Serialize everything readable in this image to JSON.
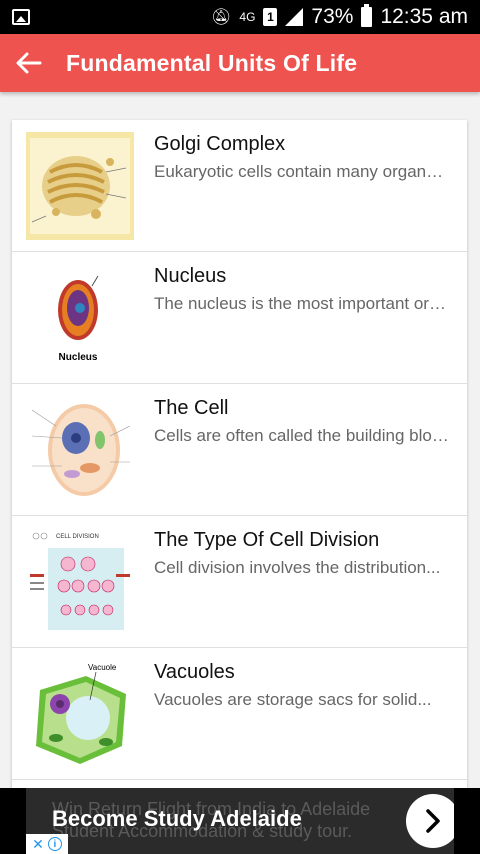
{
  "status_bar": {
    "network": "4G",
    "sim": "1",
    "battery": "73%",
    "time": "12:35 am"
  },
  "app_bar": {
    "back_icon": "arrow-left-icon",
    "title": "Fundamental Units Of Life"
  },
  "list": {
    "items": [
      {
        "title": "Golgi Complex",
        "description": "Eukaryotic cells contain many organelles..."
      },
      {
        "title": "Nucleus",
        "description": "The nucleus is the most important organelle..."
      },
      {
        "title": "The Cell",
        "description": "Cells are often called the building blocks..."
      },
      {
        "title": "The Type Of Cell Division",
        "description": "Cell division involves the distribution..."
      },
      {
        "title": "Vacuoles",
        "description": "Vacuoles are storage sacs for solid..."
      }
    ],
    "thumb_labels": {
      "nucleus": "Nucleus",
      "cell_division": "CELL DIVISION",
      "vacuole": "Vacuole"
    }
  },
  "ad": {
    "background_text_1": "Win Return Flight from India to Adelaide",
    "background_text_2": "Student Accommodation & study tour.",
    "headline": "Become Study Adelaide",
    "arrow_icon": "chevron-right-icon",
    "choices_x": "✕",
    "choices_i": "i"
  },
  "colors": {
    "app_bar": "#ef5350",
    "status_bar": "#000000",
    "accent_blue": "#2196f3"
  }
}
